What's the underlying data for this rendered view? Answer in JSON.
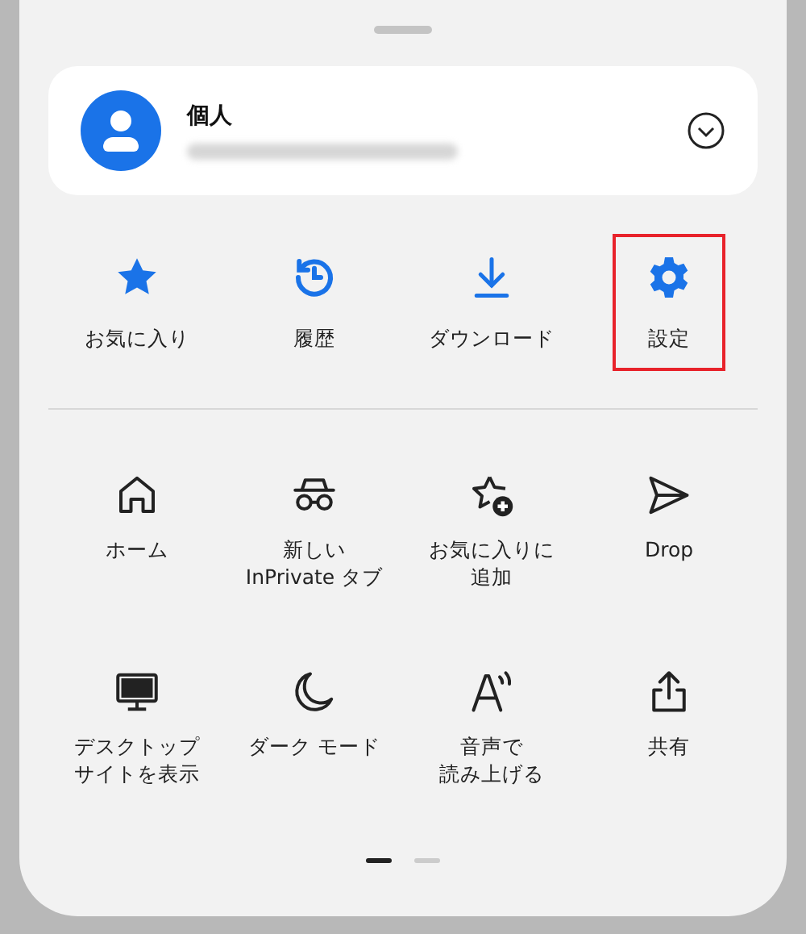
{
  "account": {
    "name": "個人",
    "email_blurred": true
  },
  "quick_actions": [
    {
      "lines": [
        "お気に入り"
      ],
      "kind": "star",
      "highlighted": false
    },
    {
      "lines": [
        "履歴"
      ],
      "kind": "history",
      "highlighted": false
    },
    {
      "lines": [
        "ダウンロード"
      ],
      "kind": "download",
      "highlighted": false
    },
    {
      "lines": [
        "設定"
      ],
      "kind": "gear",
      "highlighted": true
    }
  ],
  "menu_items": [
    {
      "lines": [
        "ホーム"
      ],
      "kind": "home"
    },
    {
      "lines": [
        "新しい",
        "InPrivate タブ"
      ],
      "kind": "incognito"
    },
    {
      "lines": [
        "お気に入りに",
        "追加"
      ],
      "kind": "star-plus"
    },
    {
      "lines": [
        "Drop"
      ],
      "kind": "send"
    },
    {
      "lines": [
        "デスクトップ",
        "サイトを表示"
      ],
      "kind": "desktop"
    },
    {
      "lines": [
        "ダーク モード"
      ],
      "kind": "moon"
    },
    {
      "lines": [
        "音声で",
        "読み上げる"
      ],
      "kind": "read-aloud"
    },
    {
      "lines": [
        "共有"
      ],
      "kind": "share"
    }
  ],
  "pages": [
    {
      "selected": true
    },
    {
      "selected": false
    }
  ]
}
